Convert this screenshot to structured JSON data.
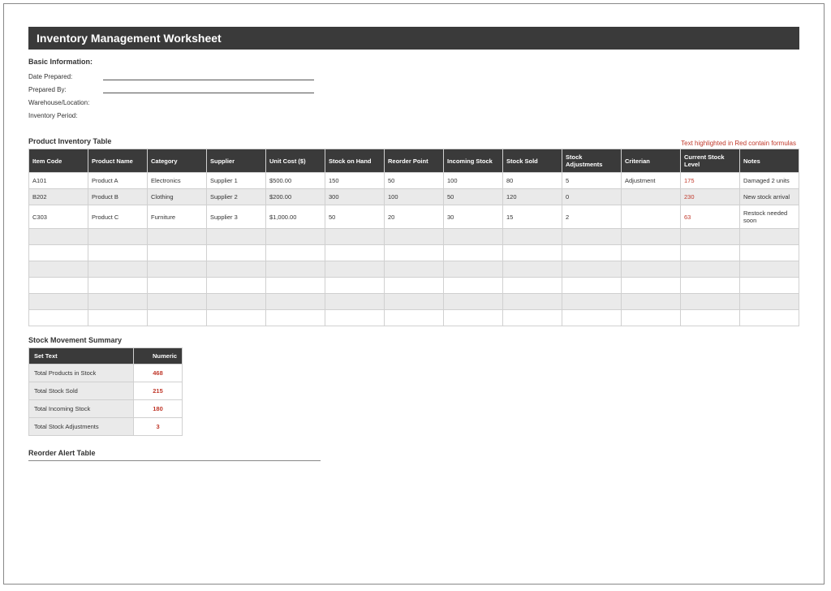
{
  "title": "Inventory Management Worksheet",
  "basic_info": {
    "heading": "Basic Information:",
    "fields": [
      {
        "label": "Date Prepared:",
        "underline": true
      },
      {
        "label": "Prepared By:",
        "underline": true
      },
      {
        "label": "Warehouse/Location:",
        "underline": false
      },
      {
        "label": "Inventory Period:",
        "underline": false
      }
    ]
  },
  "product_table": {
    "heading": "Product Inventory Table",
    "formula_note": "Text highlighted in Red contain formulas",
    "columns": [
      "Item Code",
      "Product Name",
      "Category",
      "Supplier",
      "Unit Cost ($)",
      "Stock on Hand",
      "Reorder Point",
      "Incoming Stock",
      "Stock Sold",
      "Stock Adjustments",
      "Criterian",
      "Current Stock Level",
      "Notes"
    ],
    "rows": [
      {
        "cells": [
          "A101",
          "Product A",
          "Electronics",
          "Supplier 1",
          "$500.00",
          "150",
          "50",
          "100",
          "80",
          "5",
          "Adjustment",
          "175",
          "Damaged 2 units"
        ],
        "alt": false
      },
      {
        "cells": [
          "B202",
          "Product B",
          "Clothing",
          "Supplier 2",
          "$200.00",
          "300",
          "100",
          "50",
          "120",
          "0",
          "",
          "230",
          "New stock arrival"
        ],
        "alt": true
      },
      {
        "cells": [
          "C303",
          "Product C",
          "Furniture",
          "Supplier 3",
          "$1,000.00",
          "50",
          "20",
          "30",
          "15",
          "2",
          "",
          "63",
          "Restock needed soon"
        ],
        "alt": false
      },
      {
        "cells": [
          "",
          "",
          "",
          "",
          "",
          "",
          "",
          "",
          "",
          "",
          "",
          "",
          ""
        ],
        "alt": true
      },
      {
        "cells": [
          "",
          "",
          "",
          "",
          "",
          "",
          "",
          "",
          "",
          "",
          "",
          "",
          ""
        ],
        "alt": false
      },
      {
        "cells": [
          "",
          "",
          "",
          "",
          "",
          "",
          "",
          "",
          "",
          "",
          "",
          "",
          ""
        ],
        "alt": true
      },
      {
        "cells": [
          "",
          "",
          "",
          "",
          "",
          "",
          "",
          "",
          "",
          "",
          "",
          "",
          ""
        ],
        "alt": false
      },
      {
        "cells": [
          "",
          "",
          "",
          "",
          "",
          "",
          "",
          "",
          "",
          "",
          "",
          "",
          ""
        ],
        "alt": true
      },
      {
        "cells": [
          "",
          "",
          "",
          "",
          "",
          "",
          "",
          "",
          "",
          "",
          "",
          "",
          ""
        ],
        "alt": false
      }
    ]
  },
  "summary": {
    "heading": "Stock Movement Summary",
    "columns": {
      "label": "Set Text",
      "value": "Numeric"
    },
    "rows": [
      {
        "label": "Total Products in Stock",
        "value": "468"
      },
      {
        "label": "Total Stock Sold",
        "value": "215"
      },
      {
        "label": "Total Incoming Stock",
        "value": "180"
      },
      {
        "label": "Total Stock Adjustments",
        "value": "3"
      }
    ]
  },
  "reorder": {
    "heading": "Reorder Alert Table"
  }
}
